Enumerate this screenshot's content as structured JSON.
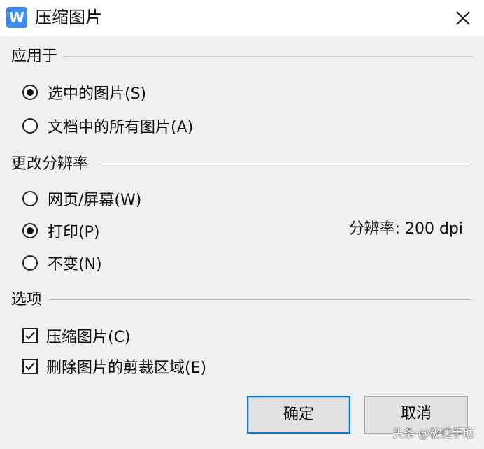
{
  "dialog": {
    "title": "压缩图片",
    "app_icon_letter": "W",
    "close_icon": "close-icon"
  },
  "apply_to": {
    "title": "应用于",
    "options": [
      {
        "label": "选中的图片(S)",
        "checked": true
      },
      {
        "label": "文档中的所有图片(A)",
        "checked": false
      }
    ]
  },
  "resolution": {
    "title": "更改分辨率",
    "options": [
      {
        "label": "网页/屏幕(W)",
        "checked": false
      },
      {
        "label": "打印(P)",
        "checked": true
      },
      {
        "label": "不变(N)",
        "checked": false
      }
    ],
    "value_text": "分辨率: 200 dpi"
  },
  "options": {
    "title": "选项",
    "items": [
      {
        "label": "压缩图片(C)",
        "checked": true
      },
      {
        "label": "删除图片的剪裁区域(E)",
        "checked": true
      }
    ]
  },
  "buttons": {
    "ok": "确定",
    "cancel": "取消"
  },
  "watermark": "头条 @极速手助",
  "colors": {
    "accent": "#0078d7",
    "app_icon": "#3f8cf0"
  }
}
